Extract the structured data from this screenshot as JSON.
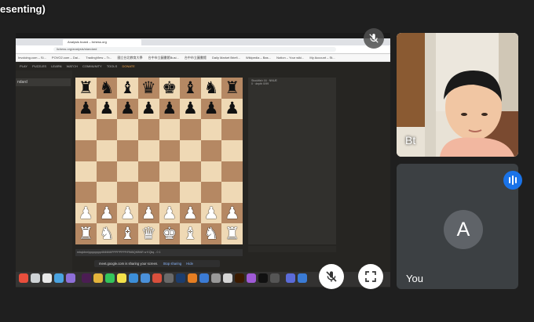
{
  "presenting_label": "esenting)",
  "browser": {
    "tab_title": "Analysis board – lichess.org",
    "url": "lichess.org/analysis/standard",
    "bookmarks": [
      "Invoicing.com – Si...",
      "POVO2.com – Dai...",
      "TradingView – Tr...",
      "國立台北教育大學",
      "台中市立圖書館Busi...",
      "台中市立圖書館",
      "Daily Market Briefi...",
      "Wikipedia – Bas...",
      "Notion – Your wiki...",
      "My Account – St..."
    ]
  },
  "site_nav": {
    "items": [
      "PLAY",
      "PUZZLES",
      "LEARN",
      "WATCH",
      "COMMUNITY",
      "TOOLS",
      "DONATE"
    ],
    "active_index": 6
  },
  "left_panel": {
    "select_value": "ndard"
  },
  "board": {
    "rows": [
      [
        "bR",
        "bN",
        "bB",
        "bQ",
        "bK",
        "bB",
        "bN",
        "bR"
      ],
      [
        "bP",
        "bP",
        "bP",
        "bP",
        "bP",
        "bP",
        "bP",
        "bP"
      ],
      [
        "",
        "",
        "",
        "",
        "",
        "",
        "",
        ""
      ],
      [
        "",
        "",
        "",
        "",
        "",
        "",
        "",
        ""
      ],
      [
        "",
        "",
        "",
        "",
        "",
        "",
        "",
        ""
      ],
      [
        "",
        "",
        "",
        "",
        "",
        "",
        "",
        ""
      ],
      [
        "wP",
        "wP",
        "wP",
        "wP",
        "wP",
        "wP",
        "wP",
        "wP"
      ],
      [
        "wR",
        "wN",
        "wB",
        "wQ",
        "wK",
        "wB",
        "wN",
        "wR"
      ]
    ]
  },
  "fen": {
    "label": "FEN",
    "value": "rnbqkbnr/pppppppp/8/8/8/8/PPPPPPPP/RNBQKBNR w KQkq - 0 1"
  },
  "right_panel": {
    "line1": "Stockfish 16 · NNUE",
    "line2": "0 · depth 0/99"
  },
  "share_banner": {
    "text": "meet.google.com is sharing your screen.",
    "stop": "Stop sharing",
    "hide": "Hide"
  },
  "participants": {
    "remote_name": "Bt",
    "self_name": "You",
    "self_initial": "A"
  },
  "colors": {
    "board_light": "#efd9b5",
    "board_dark": "#b58863",
    "accent": "#1a73e8"
  },
  "icons": [
    "mic-off-icon",
    "fullscreen-icon",
    "speaking-indicator-icon"
  ]
}
